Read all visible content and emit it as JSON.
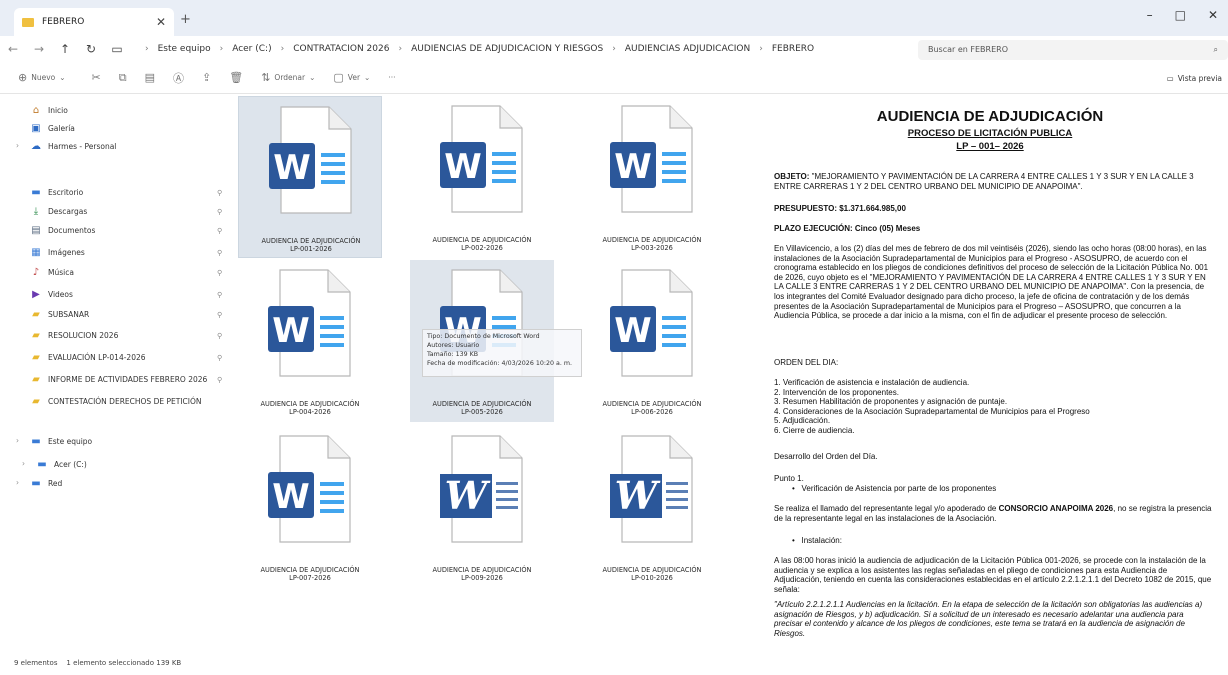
{
  "window": {
    "tab_title": "FEBRERO",
    "new_tab": "+",
    "minimize": "–",
    "maximize": "□",
    "close": "✕"
  },
  "nav": {
    "back": "←",
    "forward": "→",
    "up": "↑",
    "refresh": "↻",
    "crumbs": [
      "Este equipo",
      "Acer (C:)",
      "CONTRATACION 2026",
      "AUDIENCIAS DE ADJUDICACION Y RIESGOS",
      "AUDIENCIAS ADJUDICACION",
      "FEBRERO"
    ],
    "search_placeholder": "Buscar en FEBRERO"
  },
  "toolbar": {
    "new": "Nuevo",
    "sort": "Ordenar",
    "view": "Ver",
    "more": "···",
    "preview_pane": "Vista previa"
  },
  "sidebar": {
    "top": [
      {
        "label": "Inicio",
        "icon": "home-icon"
      },
      {
        "label": "Galería",
        "icon": "gallery-icon"
      },
      {
        "label": "Harmes - Personal",
        "icon": "cloud-icon"
      }
    ],
    "quick": [
      {
        "label": "Escritorio",
        "icon": "desktop-icon"
      },
      {
        "label": "Descargas",
        "icon": "download-icon"
      },
      {
        "label": "Documentos",
        "icon": "documents-icon"
      },
      {
        "label": "Imágenes",
        "icon": "images-icon"
      },
      {
        "label": "Música",
        "icon": "music-icon"
      },
      {
        "label": "Videos",
        "icon": "videos-icon"
      },
      {
        "label": "SUBSANAR",
        "icon": "folder-icon"
      },
      {
        "label": "RESOLUCION 2026",
        "icon": "folder-icon"
      },
      {
        "label": "EVALUACIÓN LP-014-2026",
        "icon": "folder-icon"
      },
      {
        "label": "INFORME DE ACTIVIDADES FEBRERO 2026",
        "icon": "folder-icon"
      },
      {
        "label": "CONTESTACIÓN DERECHOS DE PETICIÓN",
        "icon": "folder-icon"
      }
    ],
    "this_pc": "Este equipo",
    "drive": "Acer (C:)",
    "network": "Red"
  },
  "files": [
    {
      "name": "AUDIENCIA DE ADJUDICACIÓN",
      "code": "LP-001-2026"
    },
    {
      "name": "AUDIENCIA DE ADJUDICACIÓN",
      "code": "LP-002-2026"
    },
    {
      "name": "AUDIENCIA DE ADJUDICACIÓN",
      "code": "LP-003-2026"
    },
    {
      "name": "AUDIENCIA DE ADJUDICACIÓN",
      "code": "LP-004-2026"
    },
    {
      "name": "AUDIENCIA DE ADJUDICACIÓN",
      "code": "LP-005-2026"
    },
    {
      "name": "AUDIENCIA DE ADJUDICACIÓN",
      "code": "LP-006-2026"
    },
    {
      "name": "AUDIENCIA DE ADJUDICACIÓN",
      "code": "LP-007-2026"
    },
    {
      "name": "AUDIENCIA DE ADJUDICACIÓN",
      "code": "LP-009-2026"
    },
    {
      "name": "AUDIENCIA DE ADJUDICACIÓN",
      "code": "LP-010-2026"
    }
  ],
  "tooltip": {
    "type": "Tipo: Documento de Microsoft Word",
    "authors": "Autores: Usuario",
    "size": "Tamaño: 139 KB",
    "modified": "Fecha de modificación: 4/03/2026 10:20 a. m."
  },
  "preview": {
    "title": "AUDIENCIA DE ADJUDICACIÓN",
    "subtitle": "PROCESO DE LICITACIÓN PUBLICA",
    "code": "LP – 001– 2026",
    "objeto_label": "OBJETO:",
    "objeto": "\"MEJORAMIENTO Y PAVIMENTACIÓN DE LA CARRERA 4 ENTRE CALLES 1 Y 3 SUR Y EN LA CALLE 3 ENTRE CARRERAS 1 Y 2 DEL CENTRO URBANO DEL MUNICIPIO DE ANAPOIMA\".",
    "presupuesto": "PRESUPUESTO: $1.371.664.985,00",
    "plazo": "PLAZO EJECUCIÓN: Cinco (05) Meses",
    "intro": "En Villavicencio, a los (2) días del mes de febrero de dos mil veintiséis (2026), siendo las ocho horas (08:00 horas), en las instalaciones de la Asociación Supradepartamental de Municipios para el Progreso - ASOSUPRO, de acuerdo con el cronograma establecido en los pliegos de condiciones definitivos del proceso de selección de la Licitación Pública No. 001 de 2026, cuyo objeto es el \"MEJORAMIENTO Y PAVIMENTACIÓN DE LA CARRERA 4 ENTRE CALLES 1 Y 3 SUR Y EN LA CALLE 3 ENTRE CARRERAS 1 Y 2 DEL CENTRO URBANO DEL MUNICIPIO DE ANAPOIMA\". Con la presencia, de los integrantes del Comité Evaluador designado para dicho proceso, la jefe de oficina de contratación y de los demás presentes de la Asociación Supradepartamental de Municipios para el Progreso – ASOSUPRO, que concurren a la Audiencia Pública, se procede a dar inicio a la misma, con el fin de adjudicar el presente proceso de selección.",
    "orden_title": "ORDEN DEL DIA:",
    "orden": [
      "1. Verificación de asistencia e instalación de audiencia.",
      "2. Intervención de los proponentes.",
      "3. Resumen Habilitación de proponentes y asignación de puntaje.",
      "4. Consideraciones de la Asociación Supradepartamental de Municipios para el Progreso",
      "5. Adjudicación.",
      "6. Cierre de audiencia."
    ],
    "desarrollo": "Desarrollo del Orden del Día.",
    "punto": "Punto 1.",
    "punto_bullet": "Verificación de Asistencia por parte de los proponentes",
    "asistencia_pre": "Se realiza el llamado del representante legal y/o apoderado de ",
    "asistencia_bold": "CONSORCIO ANAPOIMA 2026",
    "asistencia_post": ", no se registra la presencia de la representante legal en las instalaciones de la Asociación.",
    "instalacion": "Instalación:",
    "instalacion_text": "A las 08:00 horas inició la audiencia de adjudicación de la Licitación Pública 001-2026, se procede con la instalación de la audiencia y se explica a los asistentes las reglas señaladas en el pliego de condiciones para esta Audiencia de Adjudicación, teniendo en cuenta las consideraciones establecidas en el artículo 2.2.1.2.1.1 del Decreto 1082 de 2015, que señala:",
    "articulo": "\"Artículo 2.2.1.2.1.1 Audiencias en la licitación. En la etapa de selección de la licitación son obligatorias las audiencias a) asignación de Riesgos, y b) adjudicación. Si a solicitud de un interesado es necesario adelantar una audiencia para precisar el contenido y alcance de los pliegos de condiciones, este tema se tratará en la audiencia de asignación de Riesgos."
  },
  "status": {
    "count": "9 elementos",
    "selected": "1 elemento seleccionado  139 KB"
  },
  "colors": {
    "word_blue": "#2b579a",
    "word_blue_light": "#41a5ee",
    "selection": "#dde4ec"
  }
}
